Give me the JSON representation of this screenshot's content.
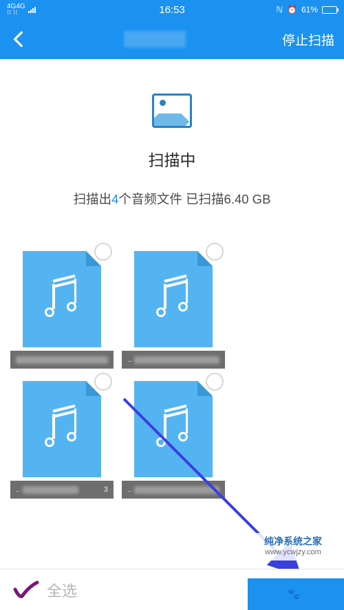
{
  "status_bar": {
    "network": "4G",
    "time": "16:53",
    "battery_pct": "61%"
  },
  "nav": {
    "title_blurred": "",
    "stop_label": "停止扫描"
  },
  "scan": {
    "scanning_label": "扫描中",
    "result_prefix": "扫描出",
    "count": "4",
    "result_mid": "个音频文件 已扫描",
    "size": "6.40 GB"
  },
  "files": [
    {
      "caption_prefix": "",
      "caption_suffix": ""
    },
    {
      "caption_prefix": "..",
      "caption_suffix": ""
    },
    {
      "caption_prefix": "..",
      "caption_suffix": "3"
    },
    {
      "caption_prefix": "..",
      "caption_suffix": ""
    }
  ],
  "bottom": {
    "select_all": "全选",
    "primary_label": ""
  },
  "watermark": {
    "line1": "纯净系统之家",
    "line2": "www.ycwjzy.com"
  }
}
